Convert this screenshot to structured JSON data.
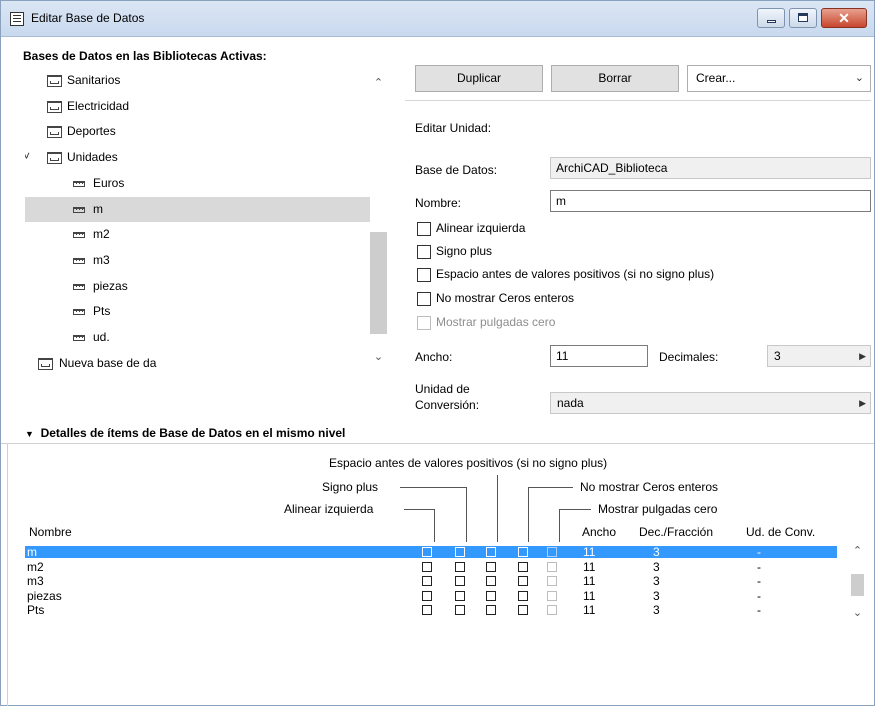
{
  "window": {
    "title": "Editar Base de Datos",
    "minimize_icon": "minimize-icon",
    "maximize_icon": "maximize-icon",
    "close_icon": "close-icon",
    "close_glyph": "✕"
  },
  "tree": {
    "heading": "Bases de Datos en las Bibliotecas Activas:",
    "items": [
      {
        "label": "Sanitarios",
        "icon": "database-folder-icon",
        "level": 1,
        "selected": false
      },
      {
        "label": "Electricidad",
        "icon": "database-folder-icon",
        "level": 1,
        "selected": false
      },
      {
        "label": "Deportes",
        "icon": "database-folder-icon",
        "level": 1,
        "selected": false
      },
      {
        "label": "Unidades",
        "icon": "units-folder-icon",
        "level": 1,
        "selected": false,
        "expanded": true
      },
      {
        "label": "Euros",
        "icon": "unit-icon",
        "level": 2,
        "selected": false
      },
      {
        "label": "m",
        "icon": "unit-icon",
        "level": 2,
        "selected": true
      },
      {
        "label": "m2",
        "icon": "unit-icon",
        "level": 2,
        "selected": false
      },
      {
        "label": "m3",
        "icon": "unit-icon",
        "level": 2,
        "selected": false
      },
      {
        "label": "piezas",
        "icon": "unit-icon",
        "level": 2,
        "selected": false
      },
      {
        "label": "Pts",
        "icon": "unit-icon",
        "level": 2,
        "selected": false
      },
      {
        "label": "ud.",
        "icon": "unit-icon",
        "level": 2,
        "selected": false
      },
      {
        "label": "Nueva base de da",
        "icon": "database-icon",
        "level": 0,
        "selected": false
      }
    ]
  },
  "toolbar": {
    "duplicate_label": "Duplicar",
    "delete_label": "Borrar",
    "create_select_value": "Crear..."
  },
  "edit": {
    "section_label": "Editar Unidad:",
    "database_label": "Base de Datos:",
    "database_value": "ArchiCAD_Biblioteca",
    "name_label": "Nombre:",
    "name_value": "m",
    "options": [
      {
        "label": "Alinear izquierda",
        "checked": false,
        "disabled": false
      },
      {
        "label": "Signo plus",
        "checked": false,
        "disabled": false
      },
      {
        "label": "Espacio antes de valores positivos (si no signo plus)",
        "checked": false,
        "disabled": false
      },
      {
        "label": "No mostrar Ceros enteros",
        "checked": false,
        "disabled": false
      },
      {
        "label": "Mostrar pulgadas cero",
        "checked": false,
        "disabled": true
      }
    ],
    "width_label": "Ancho:",
    "width_value": "11",
    "decimals_label": "Decimales:",
    "decimals_value": "3",
    "conversion_label_line1": "Unidad de",
    "conversion_label_line2": "Conversión:",
    "conversion_value": "nada"
  },
  "details": {
    "heading": "Detalles de ítems de Base de Datos en el mismo nivel",
    "col_labels": {
      "espacio": "Espacio antes de valores positivos (si no signo plus)",
      "signo": "Signo plus",
      "no_ceros": "No mostrar Ceros enteros",
      "alinear": "Alinear izquierda",
      "pulgadas": "Mostrar pulgadas cero"
    },
    "headers": {
      "name": "Nombre",
      "width": "Ancho",
      "dec": "Dec./Fracción",
      "conv": "Ud. de Conv."
    },
    "rows": [
      {
        "name": "m",
        "width": "11",
        "dec": "3",
        "conv": "-",
        "selected": true
      },
      {
        "name": "m2",
        "width": "11",
        "dec": "3",
        "conv": "-",
        "selected": false
      },
      {
        "name": "m3",
        "width": "11",
        "dec": "3",
        "conv": "-",
        "selected": false
      },
      {
        "name": "piezas",
        "width": "11",
        "dec": "3",
        "conv": "-",
        "selected": false
      },
      {
        "name": "Pts",
        "width": "11",
        "dec": "3",
        "conv": "-",
        "selected": false
      }
    ]
  },
  "colors": {
    "selection": "#3399ff",
    "tree_selection": "#d9d9d9",
    "titlebar": "#dbe6f4",
    "close_button": "#c7462d"
  }
}
